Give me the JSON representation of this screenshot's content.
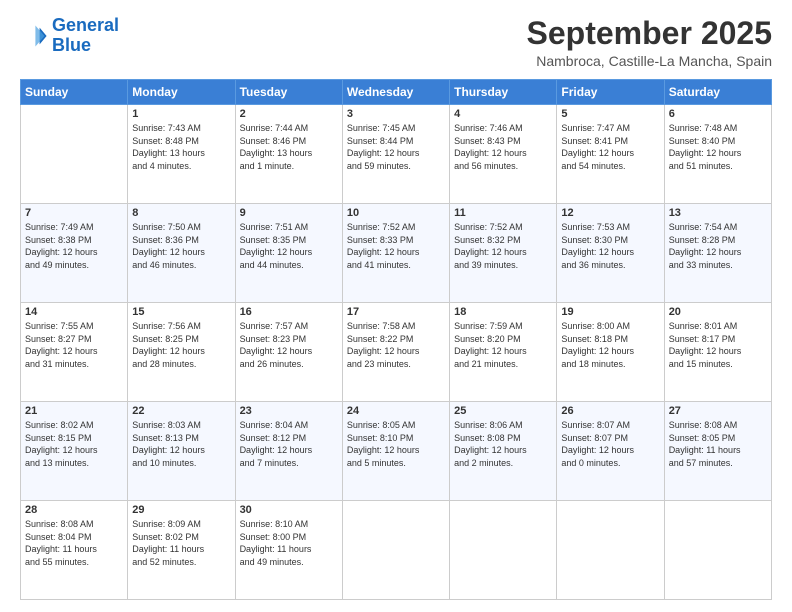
{
  "logo": {
    "line1": "General",
    "line2": "Blue"
  },
  "header": {
    "month": "September 2025",
    "location": "Nambroca, Castille-La Mancha, Spain"
  },
  "days_of_week": [
    "Sunday",
    "Monday",
    "Tuesday",
    "Wednesday",
    "Thursday",
    "Friday",
    "Saturday"
  ],
  "weeks": [
    [
      {
        "day": "",
        "info": ""
      },
      {
        "day": "1",
        "info": "Sunrise: 7:43 AM\nSunset: 8:48 PM\nDaylight: 13 hours\nand 4 minutes."
      },
      {
        "day": "2",
        "info": "Sunrise: 7:44 AM\nSunset: 8:46 PM\nDaylight: 13 hours\nand 1 minute."
      },
      {
        "day": "3",
        "info": "Sunrise: 7:45 AM\nSunset: 8:44 PM\nDaylight: 12 hours\nand 59 minutes."
      },
      {
        "day": "4",
        "info": "Sunrise: 7:46 AM\nSunset: 8:43 PM\nDaylight: 12 hours\nand 56 minutes."
      },
      {
        "day": "5",
        "info": "Sunrise: 7:47 AM\nSunset: 8:41 PM\nDaylight: 12 hours\nand 54 minutes."
      },
      {
        "day": "6",
        "info": "Sunrise: 7:48 AM\nSunset: 8:40 PM\nDaylight: 12 hours\nand 51 minutes."
      }
    ],
    [
      {
        "day": "7",
        "info": "Sunrise: 7:49 AM\nSunset: 8:38 PM\nDaylight: 12 hours\nand 49 minutes."
      },
      {
        "day": "8",
        "info": "Sunrise: 7:50 AM\nSunset: 8:36 PM\nDaylight: 12 hours\nand 46 minutes."
      },
      {
        "day": "9",
        "info": "Sunrise: 7:51 AM\nSunset: 8:35 PM\nDaylight: 12 hours\nand 44 minutes."
      },
      {
        "day": "10",
        "info": "Sunrise: 7:52 AM\nSunset: 8:33 PM\nDaylight: 12 hours\nand 41 minutes."
      },
      {
        "day": "11",
        "info": "Sunrise: 7:52 AM\nSunset: 8:32 PM\nDaylight: 12 hours\nand 39 minutes."
      },
      {
        "day": "12",
        "info": "Sunrise: 7:53 AM\nSunset: 8:30 PM\nDaylight: 12 hours\nand 36 minutes."
      },
      {
        "day": "13",
        "info": "Sunrise: 7:54 AM\nSunset: 8:28 PM\nDaylight: 12 hours\nand 33 minutes."
      }
    ],
    [
      {
        "day": "14",
        "info": "Sunrise: 7:55 AM\nSunset: 8:27 PM\nDaylight: 12 hours\nand 31 minutes."
      },
      {
        "day": "15",
        "info": "Sunrise: 7:56 AM\nSunset: 8:25 PM\nDaylight: 12 hours\nand 28 minutes."
      },
      {
        "day": "16",
        "info": "Sunrise: 7:57 AM\nSunset: 8:23 PM\nDaylight: 12 hours\nand 26 minutes."
      },
      {
        "day": "17",
        "info": "Sunrise: 7:58 AM\nSunset: 8:22 PM\nDaylight: 12 hours\nand 23 minutes."
      },
      {
        "day": "18",
        "info": "Sunrise: 7:59 AM\nSunset: 8:20 PM\nDaylight: 12 hours\nand 21 minutes."
      },
      {
        "day": "19",
        "info": "Sunrise: 8:00 AM\nSunset: 8:18 PM\nDaylight: 12 hours\nand 18 minutes."
      },
      {
        "day": "20",
        "info": "Sunrise: 8:01 AM\nSunset: 8:17 PM\nDaylight: 12 hours\nand 15 minutes."
      }
    ],
    [
      {
        "day": "21",
        "info": "Sunrise: 8:02 AM\nSunset: 8:15 PM\nDaylight: 12 hours\nand 13 minutes."
      },
      {
        "day": "22",
        "info": "Sunrise: 8:03 AM\nSunset: 8:13 PM\nDaylight: 12 hours\nand 10 minutes."
      },
      {
        "day": "23",
        "info": "Sunrise: 8:04 AM\nSunset: 8:12 PM\nDaylight: 12 hours\nand 7 minutes."
      },
      {
        "day": "24",
        "info": "Sunrise: 8:05 AM\nSunset: 8:10 PM\nDaylight: 12 hours\nand 5 minutes."
      },
      {
        "day": "25",
        "info": "Sunrise: 8:06 AM\nSunset: 8:08 PM\nDaylight: 12 hours\nand 2 minutes."
      },
      {
        "day": "26",
        "info": "Sunrise: 8:07 AM\nSunset: 8:07 PM\nDaylight: 12 hours\nand 0 minutes."
      },
      {
        "day": "27",
        "info": "Sunrise: 8:08 AM\nSunset: 8:05 PM\nDaylight: 11 hours\nand 57 minutes."
      }
    ],
    [
      {
        "day": "28",
        "info": "Sunrise: 8:08 AM\nSunset: 8:04 PM\nDaylight: 11 hours\nand 55 minutes."
      },
      {
        "day": "29",
        "info": "Sunrise: 8:09 AM\nSunset: 8:02 PM\nDaylight: 11 hours\nand 52 minutes."
      },
      {
        "day": "30",
        "info": "Sunrise: 8:10 AM\nSunset: 8:00 PM\nDaylight: 11 hours\nand 49 minutes."
      },
      {
        "day": "",
        "info": ""
      },
      {
        "day": "",
        "info": ""
      },
      {
        "day": "",
        "info": ""
      },
      {
        "day": "",
        "info": ""
      }
    ]
  ]
}
